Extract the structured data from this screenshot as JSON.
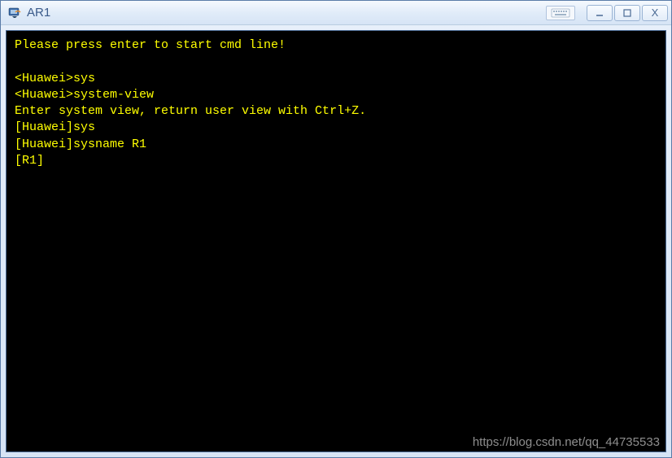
{
  "window": {
    "title": "AR1",
    "icon_name": "ensp-device-icon"
  },
  "controls": {
    "minimize": "—",
    "maximize": "□",
    "close": "X",
    "input_indicator": "⌨"
  },
  "terminal": {
    "lines": [
      "Please press enter to start cmd line!",
      "",
      "<Huawei>sys",
      "<Huawei>system-view",
      "Enter system view, return user view with Ctrl+Z.",
      "[Huawei]sys",
      "[Huawei]sysname R1",
      "[R1]"
    ]
  },
  "watermark": "https://blog.csdn.net/qq_44735533"
}
